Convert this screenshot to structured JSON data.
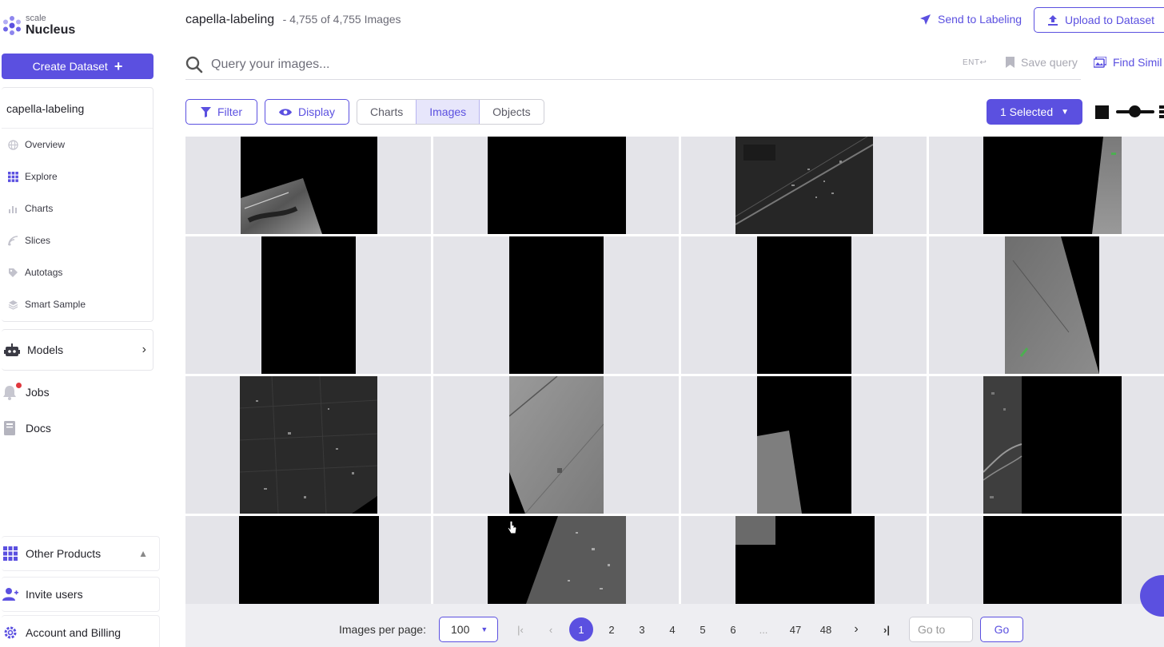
{
  "brand": {
    "small": "scale",
    "name": "Nucleus"
  },
  "sidebar": {
    "create_label": "Create Dataset",
    "dataset_name": "capella-labeling",
    "nav": [
      {
        "label": "Overview",
        "icon": "globe-icon"
      },
      {
        "label": "Explore",
        "icon": "grid-icon"
      },
      {
        "label": "Charts",
        "icon": "bar-chart-icon"
      },
      {
        "label": "Slices",
        "icon": "slices-icon"
      },
      {
        "label": "Autotags",
        "icon": "tag-icon"
      },
      {
        "label": "Smart Sample",
        "icon": "layers-icon"
      }
    ],
    "models_label": "Models",
    "jobs_label": "Jobs",
    "docs_label": "Docs",
    "other_products_label": "Other Products",
    "invite_label": "Invite users",
    "account_label": "Account and Billing"
  },
  "header": {
    "title": "capella-labeling",
    "count": "- 4,755 of 4,755 Images",
    "send_label": "Send to Labeling",
    "upload_label": "Upload to Dataset"
  },
  "query": {
    "placeholder": "Query your images...",
    "ent_hint": "ENT↩",
    "save_label": "Save query",
    "find_similar_label": "Find Simil"
  },
  "toolbar": {
    "filter_label": "Filter",
    "display_label": "Display",
    "tabs": [
      "Charts",
      "Images",
      "Objects"
    ],
    "active_tab": "Images",
    "selected_label": "1 Selected"
  },
  "pagination": {
    "per_page_label": "Images per page:",
    "per_page_value": "100",
    "pages": [
      "1",
      "2",
      "3",
      "4",
      "5",
      "6",
      "...",
      "47",
      "48"
    ],
    "current_page": "1",
    "goto_placeholder": "Go to",
    "go_label": "Go"
  },
  "colors": {
    "accent": "#5b50e0",
    "cell_bg": "#e4e4e9",
    "badge": "#e0383e"
  }
}
